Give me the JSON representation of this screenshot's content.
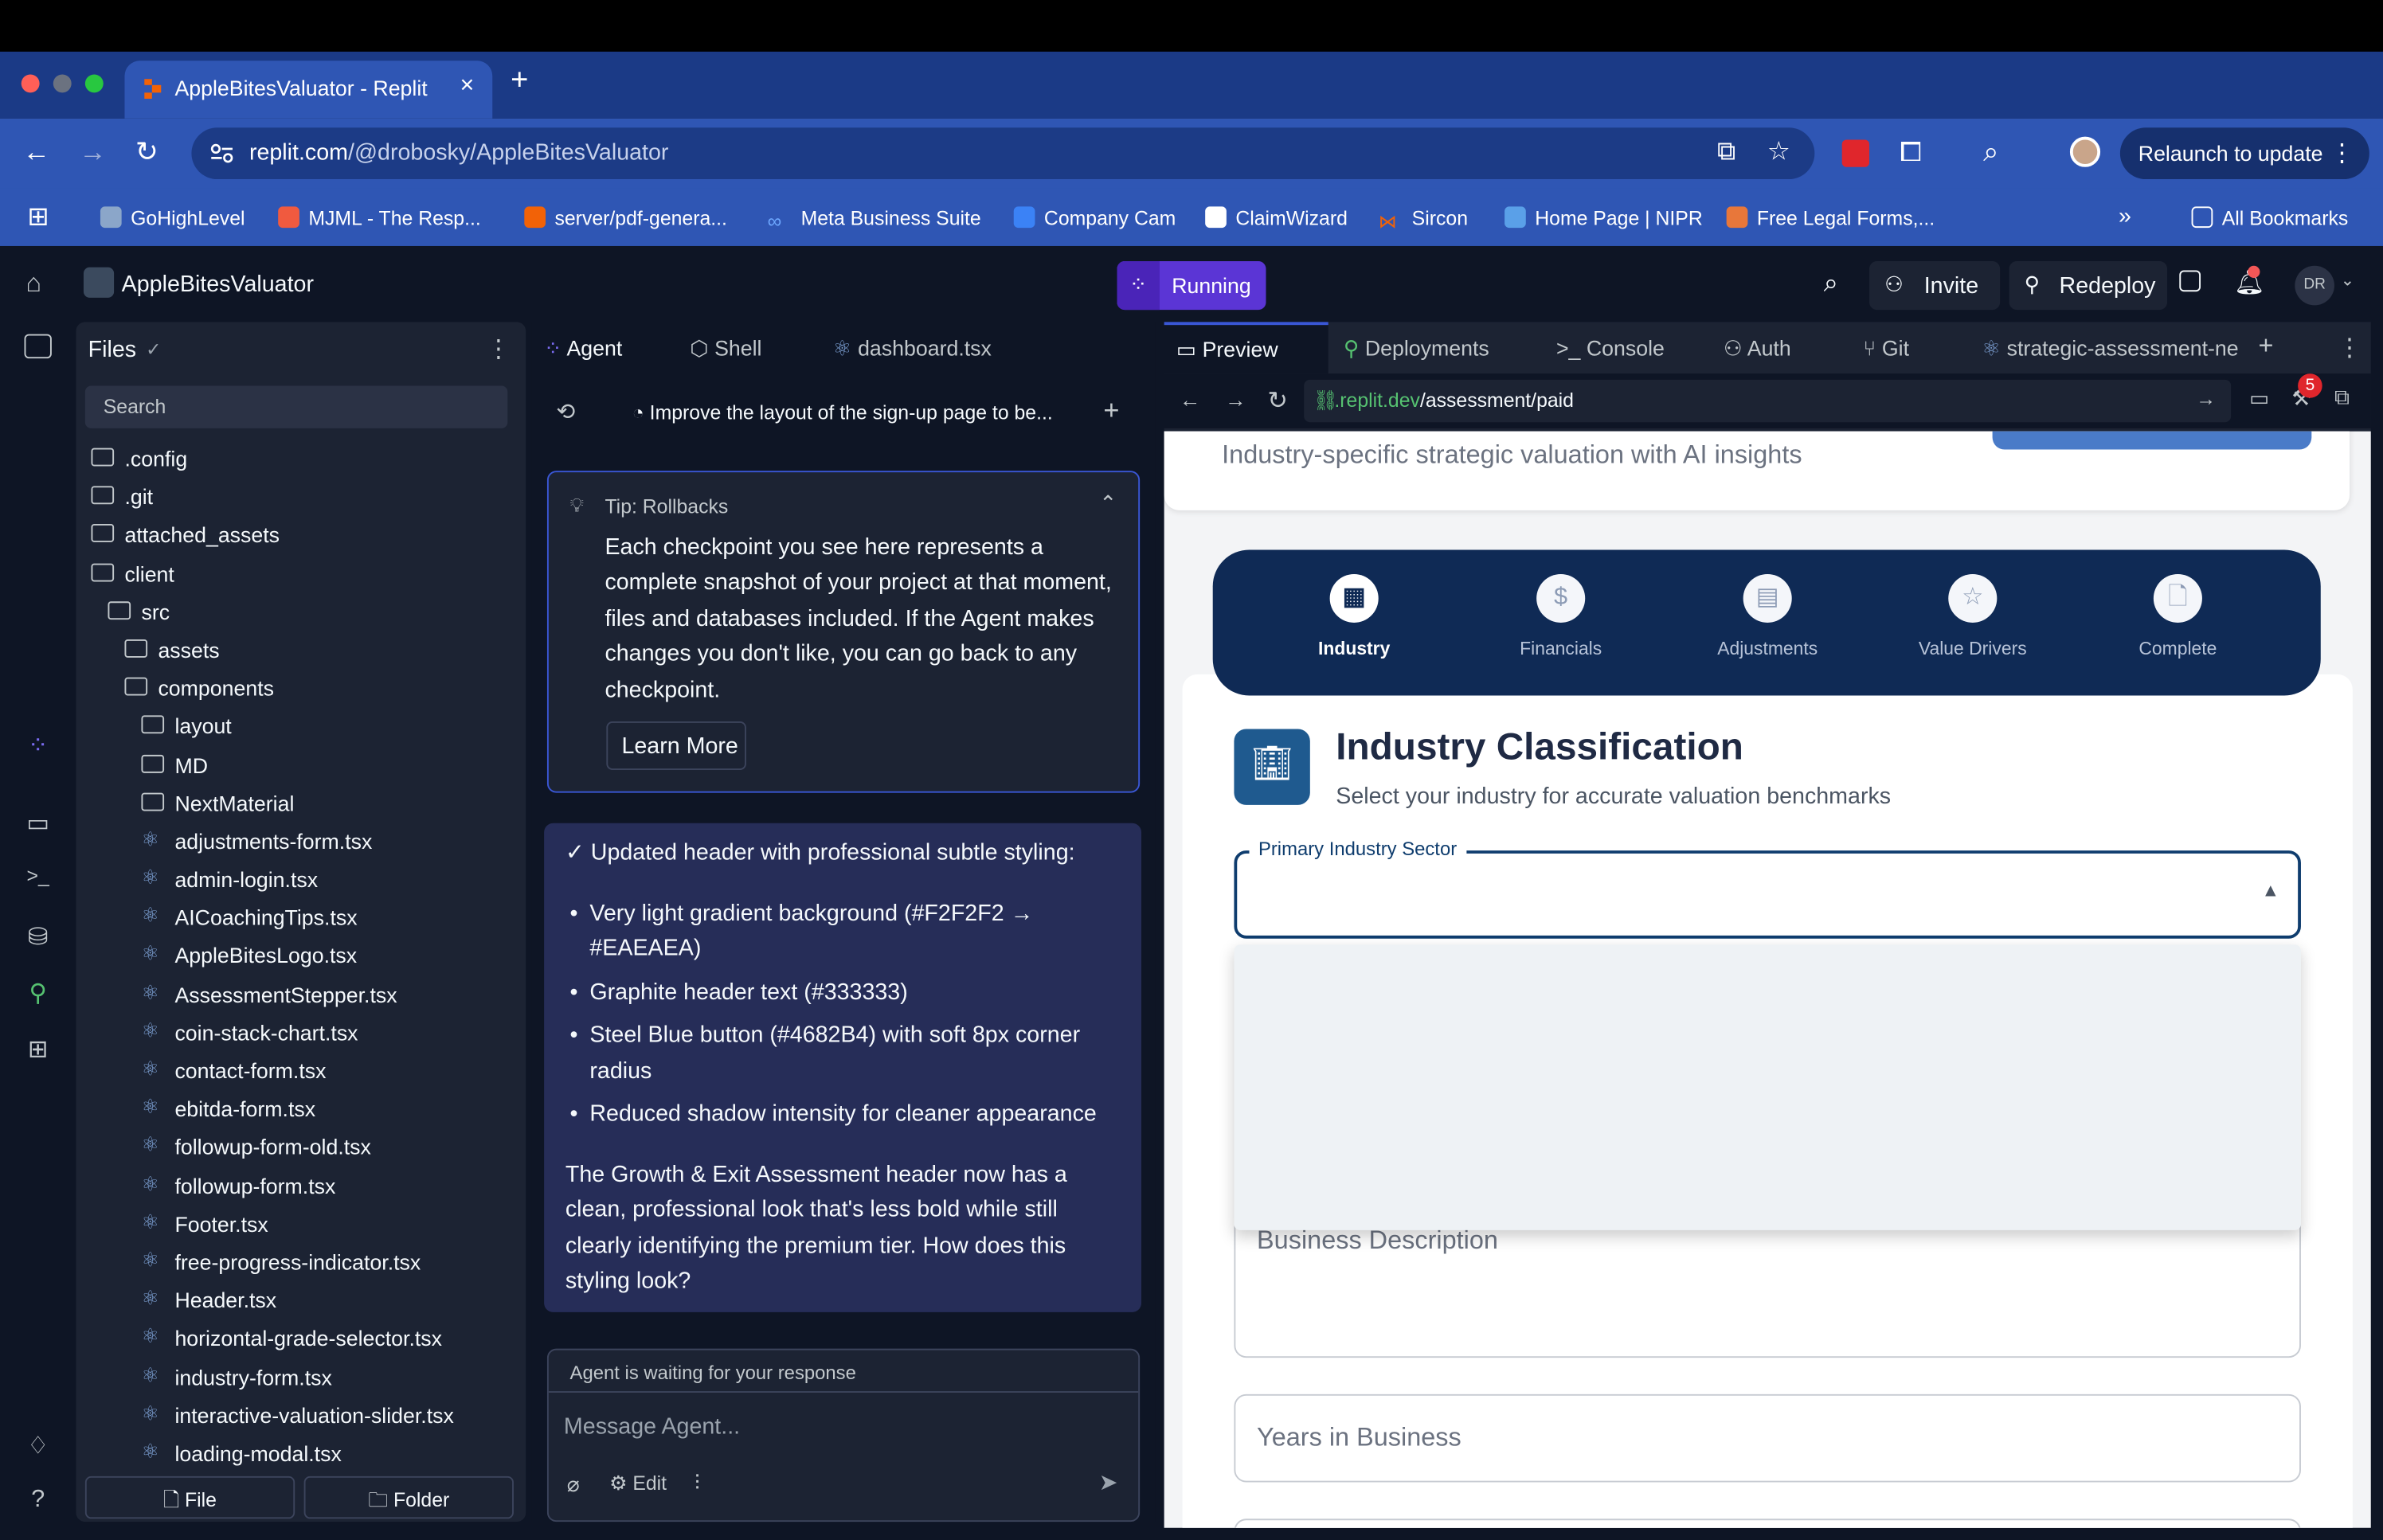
{
  "browser": {
    "tab_title": "AppleBitesValuator - Replit",
    "new_tab": "+",
    "close_tab": "×",
    "url_host": "replit.com",
    "url_path": "/@drobosky/AppleBitesValuator",
    "relaunch": "Relaunch to update",
    "bookmarks": [
      "GoHighLevel",
      "MJML - The Resp...",
      "server/pdf-genera...",
      "Meta Business Suite",
      "Company Cam",
      "ClaimWizard",
      "Sircon",
      "Home Page | NIPR",
      "Free Legal Forms,..."
    ],
    "all_bookmarks": "All Bookmarks"
  },
  "app": {
    "project_name": "AppleBitesValuator",
    "status": "Running",
    "invite": "Invite",
    "redeploy": "Redeploy",
    "avatar": "DR"
  },
  "files": {
    "title": "Files",
    "search_placeholder": "Search",
    "tree": [
      {
        "name": ".config",
        "type": "folder",
        "depth": 0
      },
      {
        "name": ".git",
        "type": "folder",
        "depth": 0
      },
      {
        "name": "attached_assets",
        "type": "folder",
        "depth": 0
      },
      {
        "name": "client",
        "type": "folder",
        "depth": 0
      },
      {
        "name": "src",
        "type": "folder",
        "depth": 1
      },
      {
        "name": "assets",
        "type": "folder",
        "depth": 2
      },
      {
        "name": "components",
        "type": "folder",
        "depth": 2
      },
      {
        "name": "layout",
        "type": "folder",
        "depth": 3
      },
      {
        "name": "MD",
        "type": "folder",
        "depth": 3
      },
      {
        "name": "NextMaterial",
        "type": "folder",
        "depth": 3
      },
      {
        "name": "adjustments-form.tsx",
        "type": "tsx",
        "depth": 3
      },
      {
        "name": "admin-login.tsx",
        "type": "tsx",
        "depth": 3
      },
      {
        "name": "AICoachingTips.tsx",
        "type": "tsx",
        "depth": 3
      },
      {
        "name": "AppleBitesLogo.tsx",
        "type": "tsx",
        "depth": 3
      },
      {
        "name": "AssessmentStepper.tsx",
        "type": "tsx",
        "depth": 3
      },
      {
        "name": "coin-stack-chart.tsx",
        "type": "tsx",
        "depth": 3
      },
      {
        "name": "contact-form.tsx",
        "type": "tsx",
        "depth": 3
      },
      {
        "name": "ebitda-form.tsx",
        "type": "tsx",
        "depth": 3
      },
      {
        "name": "followup-form-old.tsx",
        "type": "tsx",
        "depth": 3
      },
      {
        "name": "followup-form.tsx",
        "type": "tsx",
        "depth": 3
      },
      {
        "name": "Footer.tsx",
        "type": "tsx",
        "depth": 3
      },
      {
        "name": "free-progress-indicator.tsx",
        "type": "tsx",
        "depth": 3
      },
      {
        "name": "Header.tsx",
        "type": "tsx",
        "depth": 3
      },
      {
        "name": "horizontal-grade-selector.tsx",
        "type": "tsx",
        "depth": 3
      },
      {
        "name": "industry-form.tsx",
        "type": "tsx",
        "depth": 3
      },
      {
        "name": "interactive-valuation-slider.tsx",
        "type": "tsx",
        "depth": 3
      },
      {
        "name": "loading-modal.tsx",
        "type": "tsx",
        "depth": 3
      }
    ],
    "new_file": "File",
    "new_folder": "Folder"
  },
  "agent": {
    "tabs": [
      "Agent",
      "Shell",
      "dashboard.tsx"
    ],
    "thread_title": "Improve the layout of the sign-up page to be...",
    "tip_title": "Tip: Rollbacks",
    "tip_body": "Each checkpoint you see here represents a complete snapshot of your project at that moment, files and databases included. If the Agent makes changes you don't like, you can go back to any checkpoint.",
    "learn_more": "Learn More",
    "message_heading": "✓ Updated header with professional subtle styling:",
    "bullets": [
      "Very light gradient background (#F2F2F2 → #EAEAEA)",
      "Graphite header text (#333333)",
      "Steel Blue button (#4682B4) with soft 8px corner radius",
      "Reduced shadow intensity for cleaner appearance"
    ],
    "message_body": "The Growth & Exit Assessment header now has a clean, professional look that's less bold while still clearly identifying the premium tier. How does this styling look?",
    "waiting": "Agent is waiting for your response",
    "input_placeholder": "Message Agent...",
    "edit": "Edit"
  },
  "preview": {
    "tabs": [
      "Preview",
      "Deployments",
      "Console",
      "Auth",
      "Git",
      "strategic-assessment-ne"
    ],
    "url_host": ".replit.dev",
    "url_path": "/assessment/paid",
    "badge_count": "5",
    "page": {
      "subtitle_top": "Industry-specific strategic valuation with AI insights",
      "steps": [
        "Industry",
        "Financials",
        "Adjustments",
        "Value Drivers",
        "Complete"
      ],
      "active_step": 0,
      "section_title": "Industry Classification",
      "section_subtitle": "Select your industry for accurate valuation benchmarks",
      "primary_label": "Primary Industry Sector",
      "business_description": "Business Description",
      "years_in_business": "Years in Business"
    }
  },
  "colors": {
    "chrome_tab_bar": "#1b3a86",
    "chrome_toolbar": "#2f56b4",
    "replit_bg": "#0e1525",
    "panel_bg": "#1c2333",
    "running_accent": "#5b35d5",
    "stepper_navy": "#0f2a55",
    "field_focus": "#0f3d6e"
  }
}
